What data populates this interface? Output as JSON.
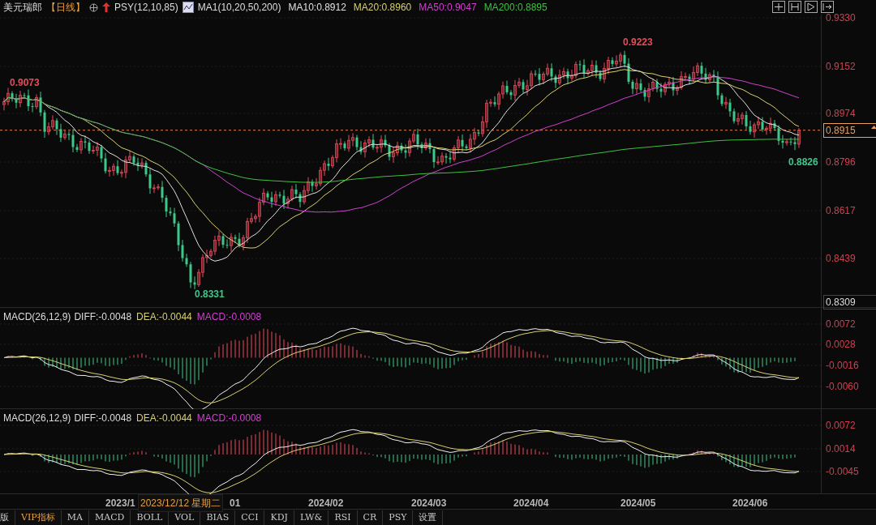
{
  "header": {
    "symbol": "美元瑞郎",
    "period": "【日线】",
    "indicator": "PSY(12,10,85)",
    "legend_title": "MA1(10,20,50,200)",
    "ma_values": [
      {
        "label": "MA10:0.8912",
        "color": "#e0e0e0"
      },
      {
        "label": "MA20:0.8960",
        "color": "#d8d070"
      },
      {
        "label": "MA50:0.9047",
        "color": "#d040d0"
      },
      {
        "label": "MA200:0.8895",
        "color": "#40c040"
      }
    ]
  },
  "price_panel": {
    "annotations": [
      {
        "text": "0.9073",
        "kind": "high"
      },
      {
        "text": "0.9223",
        "kind": "high"
      },
      {
        "text": "0.8331",
        "kind": "low"
      },
      {
        "text": "0.8826",
        "kind": "low"
      }
    ],
    "ticks": [
      "0.9330",
      "0.9152",
      "0.8974",
      "0.8796",
      "0.8617",
      "0.8439"
    ],
    "current_price": "0.8915",
    "bottom_value": "0.8309"
  },
  "macd_panels": [
    {
      "title": "MACD(26,12,9)",
      "diff": "DIFF:-0.0048",
      "dea": "DEA:-0.0044",
      "macd": "MACD:-0.0008",
      "ticks": [
        "0.0072",
        "0.0028",
        "-0.0016",
        "-0.0060"
      ]
    },
    {
      "title": "MACD(26,12,9)",
      "diff": "DIFF:-0.0048",
      "dea": "DEA:-0.0044",
      "macd": "MACD:-0.0008",
      "ticks": [
        "0.0072",
        "0.0014",
        "-0.0045"
      ]
    }
  ],
  "date_axis": {
    "labels": [
      "2023/1",
      "01",
      "2024/02",
      "2024/03",
      "2024/04",
      "2024/05",
      "2024/06"
    ],
    "tooltip": "2023/12/12 星期二"
  },
  "tabs": [
    {
      "label": "版",
      "selected": false
    },
    {
      "label": "VIP指标",
      "selected": true
    },
    {
      "label": "MA",
      "selected": false
    },
    {
      "label": "MACD",
      "selected": false
    },
    {
      "label": "BOLL",
      "selected": false
    },
    {
      "label": "VOL",
      "selected": false
    },
    {
      "label": "BIAS",
      "selected": false
    },
    {
      "label": "CCI",
      "selected": false
    },
    {
      "label": "KDJ",
      "selected": false
    },
    {
      "label": "LW&",
      "selected": false
    },
    {
      "label": "RSI",
      "selected": false
    },
    {
      "label": "CR",
      "selected": false
    },
    {
      "label": "PSY",
      "selected": false
    },
    {
      "label": "设置",
      "selected": false
    }
  ]
}
